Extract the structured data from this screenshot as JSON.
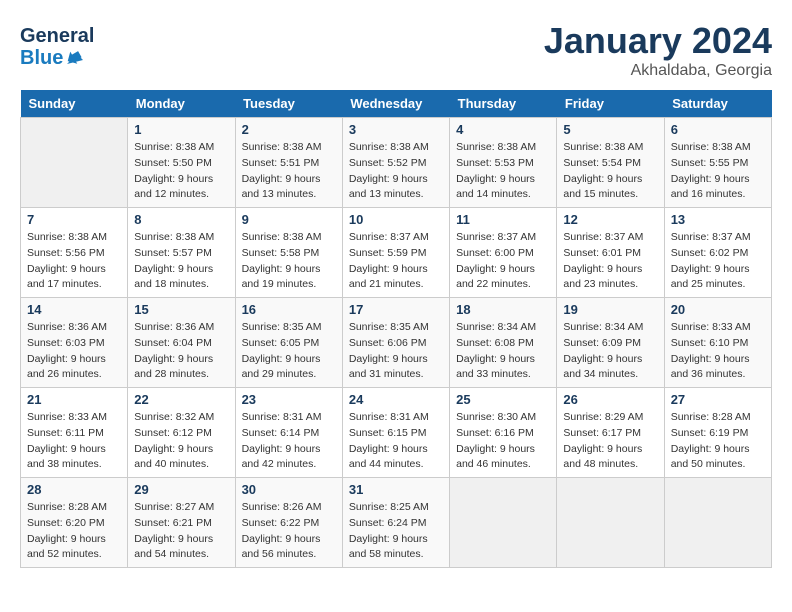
{
  "header": {
    "logo_general": "General",
    "logo_blue": "Blue",
    "main_title": "January 2024",
    "subtitle": "Akhaldaba, Georgia"
  },
  "calendar": {
    "weekdays": [
      "Sunday",
      "Monday",
      "Tuesday",
      "Wednesday",
      "Thursday",
      "Friday",
      "Saturday"
    ],
    "weeks": [
      [
        {
          "day": "",
          "sunrise": "",
          "sunset": "",
          "daylight": ""
        },
        {
          "day": "1",
          "sunrise": "Sunrise: 8:38 AM",
          "sunset": "Sunset: 5:50 PM",
          "daylight": "Daylight: 9 hours and 12 minutes."
        },
        {
          "day": "2",
          "sunrise": "Sunrise: 8:38 AM",
          "sunset": "Sunset: 5:51 PM",
          "daylight": "Daylight: 9 hours and 13 minutes."
        },
        {
          "day": "3",
          "sunrise": "Sunrise: 8:38 AM",
          "sunset": "Sunset: 5:52 PM",
          "daylight": "Daylight: 9 hours and 13 minutes."
        },
        {
          "day": "4",
          "sunrise": "Sunrise: 8:38 AM",
          "sunset": "Sunset: 5:53 PM",
          "daylight": "Daylight: 9 hours and 14 minutes."
        },
        {
          "day": "5",
          "sunrise": "Sunrise: 8:38 AM",
          "sunset": "Sunset: 5:54 PM",
          "daylight": "Daylight: 9 hours and 15 minutes."
        },
        {
          "day": "6",
          "sunrise": "Sunrise: 8:38 AM",
          "sunset": "Sunset: 5:55 PM",
          "daylight": "Daylight: 9 hours and 16 minutes."
        }
      ],
      [
        {
          "day": "7",
          "sunrise": "Sunrise: 8:38 AM",
          "sunset": "Sunset: 5:56 PM",
          "daylight": "Daylight: 9 hours and 17 minutes."
        },
        {
          "day": "8",
          "sunrise": "Sunrise: 8:38 AM",
          "sunset": "Sunset: 5:57 PM",
          "daylight": "Daylight: 9 hours and 18 minutes."
        },
        {
          "day": "9",
          "sunrise": "Sunrise: 8:38 AM",
          "sunset": "Sunset: 5:58 PM",
          "daylight": "Daylight: 9 hours and 19 minutes."
        },
        {
          "day": "10",
          "sunrise": "Sunrise: 8:37 AM",
          "sunset": "Sunset: 5:59 PM",
          "daylight": "Daylight: 9 hours and 21 minutes."
        },
        {
          "day": "11",
          "sunrise": "Sunrise: 8:37 AM",
          "sunset": "Sunset: 6:00 PM",
          "daylight": "Daylight: 9 hours and 22 minutes."
        },
        {
          "day": "12",
          "sunrise": "Sunrise: 8:37 AM",
          "sunset": "Sunset: 6:01 PM",
          "daylight": "Daylight: 9 hours and 23 minutes."
        },
        {
          "day": "13",
          "sunrise": "Sunrise: 8:37 AM",
          "sunset": "Sunset: 6:02 PM",
          "daylight": "Daylight: 9 hours and 25 minutes."
        }
      ],
      [
        {
          "day": "14",
          "sunrise": "Sunrise: 8:36 AM",
          "sunset": "Sunset: 6:03 PM",
          "daylight": "Daylight: 9 hours and 26 minutes."
        },
        {
          "day": "15",
          "sunrise": "Sunrise: 8:36 AM",
          "sunset": "Sunset: 6:04 PM",
          "daylight": "Daylight: 9 hours and 28 minutes."
        },
        {
          "day": "16",
          "sunrise": "Sunrise: 8:35 AM",
          "sunset": "Sunset: 6:05 PM",
          "daylight": "Daylight: 9 hours and 29 minutes."
        },
        {
          "day": "17",
          "sunrise": "Sunrise: 8:35 AM",
          "sunset": "Sunset: 6:06 PM",
          "daylight": "Daylight: 9 hours and 31 minutes."
        },
        {
          "day": "18",
          "sunrise": "Sunrise: 8:34 AM",
          "sunset": "Sunset: 6:08 PM",
          "daylight": "Daylight: 9 hours and 33 minutes."
        },
        {
          "day": "19",
          "sunrise": "Sunrise: 8:34 AM",
          "sunset": "Sunset: 6:09 PM",
          "daylight": "Daylight: 9 hours and 34 minutes."
        },
        {
          "day": "20",
          "sunrise": "Sunrise: 8:33 AM",
          "sunset": "Sunset: 6:10 PM",
          "daylight": "Daylight: 9 hours and 36 minutes."
        }
      ],
      [
        {
          "day": "21",
          "sunrise": "Sunrise: 8:33 AM",
          "sunset": "Sunset: 6:11 PM",
          "daylight": "Daylight: 9 hours and 38 minutes."
        },
        {
          "day": "22",
          "sunrise": "Sunrise: 8:32 AM",
          "sunset": "Sunset: 6:12 PM",
          "daylight": "Daylight: 9 hours and 40 minutes."
        },
        {
          "day": "23",
          "sunrise": "Sunrise: 8:31 AM",
          "sunset": "Sunset: 6:14 PM",
          "daylight": "Daylight: 9 hours and 42 minutes."
        },
        {
          "day": "24",
          "sunrise": "Sunrise: 8:31 AM",
          "sunset": "Sunset: 6:15 PM",
          "daylight": "Daylight: 9 hours and 44 minutes."
        },
        {
          "day": "25",
          "sunrise": "Sunrise: 8:30 AM",
          "sunset": "Sunset: 6:16 PM",
          "daylight": "Daylight: 9 hours and 46 minutes."
        },
        {
          "day": "26",
          "sunrise": "Sunrise: 8:29 AM",
          "sunset": "Sunset: 6:17 PM",
          "daylight": "Daylight: 9 hours and 48 minutes."
        },
        {
          "day": "27",
          "sunrise": "Sunrise: 8:28 AM",
          "sunset": "Sunset: 6:19 PM",
          "daylight": "Daylight: 9 hours and 50 minutes."
        }
      ],
      [
        {
          "day": "28",
          "sunrise": "Sunrise: 8:28 AM",
          "sunset": "Sunset: 6:20 PM",
          "daylight": "Daylight: 9 hours and 52 minutes."
        },
        {
          "day": "29",
          "sunrise": "Sunrise: 8:27 AM",
          "sunset": "Sunset: 6:21 PM",
          "daylight": "Daylight: 9 hours and 54 minutes."
        },
        {
          "day": "30",
          "sunrise": "Sunrise: 8:26 AM",
          "sunset": "Sunset: 6:22 PM",
          "daylight": "Daylight: 9 hours and 56 minutes."
        },
        {
          "day": "31",
          "sunrise": "Sunrise: 8:25 AM",
          "sunset": "Sunset: 6:24 PM",
          "daylight": "Daylight: 9 hours and 58 minutes."
        },
        {
          "day": "",
          "sunrise": "",
          "sunset": "",
          "daylight": ""
        },
        {
          "day": "",
          "sunrise": "",
          "sunset": "",
          "daylight": ""
        },
        {
          "day": "",
          "sunrise": "",
          "sunset": "",
          "daylight": ""
        }
      ]
    ]
  }
}
